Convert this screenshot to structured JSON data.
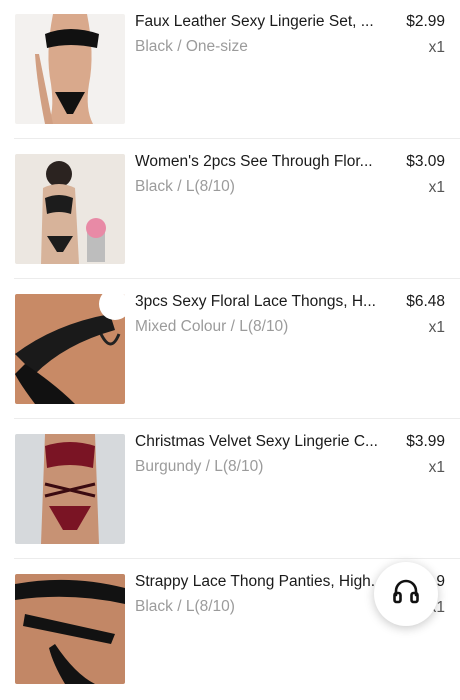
{
  "cart_items": [
    {
      "title": "Faux Leather Sexy Lingerie Set, ...",
      "variant": "Black / One-size",
      "price": "$2.99",
      "qty": "x1",
      "thumb_icon": "lingerie-set-photo"
    },
    {
      "title": "Women's 2pcs See Through Flor...",
      "variant": "Black / L(8/10)",
      "price": "$3.09",
      "qty": "x1",
      "thumb_icon": "lingerie-set-photo"
    },
    {
      "title": "3pcs Sexy Floral Lace Thongs, H...",
      "variant": "Mixed Colour / L(8/10)",
      "price": "$6.48",
      "qty": "x1",
      "thumb_icon": "thong-photo"
    },
    {
      "title": "Christmas Velvet Sexy Lingerie C...",
      "variant": "Burgundy / L(8/10)",
      "price": "$3.99",
      "qty": "x1",
      "thumb_icon": "lingerie-set-photo"
    },
    {
      "title": "Strappy Lace Thong Panties, High...",
      "variant": "Black / L(8/10)",
      "price": "$...9",
      "qty": "x1",
      "thumb_icon": "thong-photo"
    }
  ],
  "support_button": {
    "icon": "headphones-icon"
  },
  "colors": {
    "text": "#1a1a1a",
    "muted": "#9b9b9b",
    "separator": "#ececec"
  }
}
